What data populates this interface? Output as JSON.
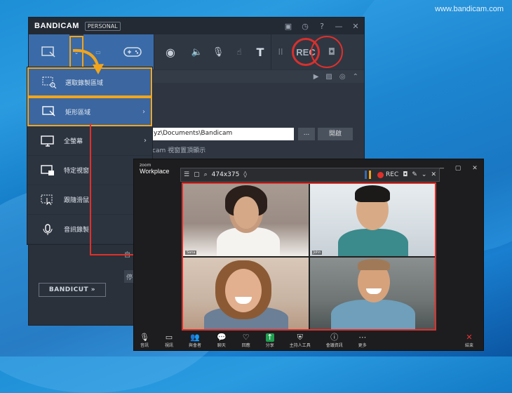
{
  "site": "www.bandicam.com",
  "bandicam": {
    "logo": "BANDICAM",
    "plan": "PERSONAL",
    "toolbar": {
      "rec_label": "REC",
      "text_icon": "T",
      "pause_icon": "II"
    },
    "path_value": "yz\\Documents\\Bandicam",
    "browse_label": "...",
    "open_label": "開啟",
    "always_on_top": "cam 視窗置頂顯示",
    "bandicut": "BANDICUT »",
    "partial_1": "自",
    "partial_2": "停"
  },
  "menu": [
    {
      "label": "選取錄製區域",
      "icon": "select-region-icon"
    },
    {
      "label": "矩形區域",
      "icon": "rectangle-region-icon",
      "arrow": "›"
    },
    {
      "label": "全螢幕",
      "icon": "fullscreen-icon",
      "arrow": "›"
    },
    {
      "label": "特定視窗",
      "icon": "window-lock-icon"
    },
    {
      "label": "跟隨滑鼠",
      "icon": "follow-mouse-icon"
    },
    {
      "label": "音訊錄製",
      "icon": "audio-record-icon"
    }
  ],
  "zoom": {
    "brand_small": "zoom",
    "brand": "Workplace",
    "rec_size": "474x375",
    "rec_label": "REC",
    "names": [
      "Sana",
      "John",
      "",
      ""
    ],
    "toolbar": [
      {
        "label": "音訊",
        "icon": "mic-icon",
        "glyph": "🎙"
      },
      {
        "label": "視訊",
        "icon": "camera-icon",
        "glyph": "▭"
      },
      {
        "label": "與會者",
        "icon": "participants-icon",
        "glyph": "👥"
      },
      {
        "label": "聊天",
        "icon": "chat-icon",
        "glyph": "💬"
      },
      {
        "label": "回應",
        "icon": "reaction-icon",
        "glyph": "♡"
      },
      {
        "label": "分享",
        "icon": "share-icon",
        "glyph": "↑"
      },
      {
        "label": "主持人工具",
        "icon": "host-tools-icon",
        "glyph": "⛨"
      },
      {
        "label": "會議資訊",
        "icon": "info-icon",
        "glyph": "ⓘ"
      },
      {
        "label": "更多",
        "icon": "more-icon",
        "glyph": "⋯"
      },
      {
        "label": "結束",
        "icon": "end-icon",
        "glyph": "✕"
      }
    ]
  },
  "colors": {
    "accent": "#3b66a0",
    "highlight": "#f2a51c",
    "rec": "#e0302a"
  }
}
